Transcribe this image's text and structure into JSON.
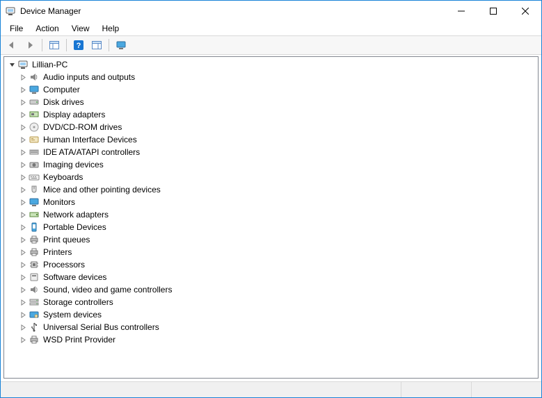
{
  "window": {
    "title": "Device Manager"
  },
  "menus": {
    "file": "File",
    "action": "Action",
    "view": "View",
    "help": "Help"
  },
  "toolbar": {
    "back": "back",
    "forward": "forward",
    "show_hide_tree": "show-hide-console-tree",
    "help": "help",
    "show_hide_action": "show-hide-action-pane",
    "monitors": "computers"
  },
  "tree": {
    "root": {
      "label": "Lillian-PC",
      "icon": "computer-icon",
      "expanded": true
    },
    "categories": [
      {
        "label": "Audio inputs and outputs",
        "icon": "speaker-icon"
      },
      {
        "label": "Computer",
        "icon": "monitor-icon"
      },
      {
        "label": "Disk drives",
        "icon": "disk-icon"
      },
      {
        "label": "Display adapters",
        "icon": "display-adapter-icon"
      },
      {
        "label": "DVD/CD-ROM drives",
        "icon": "cdrom-icon"
      },
      {
        "label": "Human Interface Devices",
        "icon": "hid-icon"
      },
      {
        "label": "IDE ATA/ATAPI controllers",
        "icon": "ide-icon"
      },
      {
        "label": "Imaging devices",
        "icon": "camera-icon"
      },
      {
        "label": "Keyboards",
        "icon": "keyboard-icon"
      },
      {
        "label": "Mice and other pointing devices",
        "icon": "mouse-icon"
      },
      {
        "label": "Monitors",
        "icon": "monitor-icon"
      },
      {
        "label": "Network adapters",
        "icon": "network-icon"
      },
      {
        "label": "Portable Devices",
        "icon": "portable-icon"
      },
      {
        "label": "Print queues",
        "icon": "printer-icon"
      },
      {
        "label": "Printers",
        "icon": "printer-icon"
      },
      {
        "label": "Processors",
        "icon": "cpu-icon"
      },
      {
        "label": "Software devices",
        "icon": "software-icon"
      },
      {
        "label": "Sound, video and game controllers",
        "icon": "sound-icon"
      },
      {
        "label": "Storage controllers",
        "icon": "storage-icon"
      },
      {
        "label": "System devices",
        "icon": "system-icon"
      },
      {
        "label": "Universal Serial Bus controllers",
        "icon": "usb-icon"
      },
      {
        "label": "WSD Print Provider",
        "icon": "printer-icon"
      }
    ]
  }
}
